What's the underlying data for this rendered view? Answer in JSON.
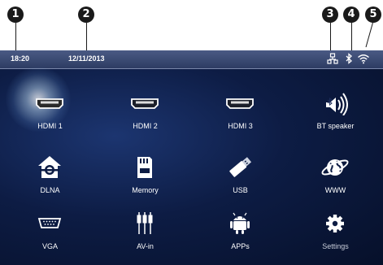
{
  "callouts": [
    "1",
    "2",
    "3",
    "4",
    "5"
  ],
  "status_bar": {
    "time": "18:20",
    "date": "12/11/2013",
    "icons": [
      "network-icon",
      "bluetooth-icon",
      "wifi-icon"
    ]
  },
  "menu": {
    "selected": "HDMI 1",
    "items": [
      {
        "label": "HDMI 1",
        "icon": "hdmi-icon"
      },
      {
        "label": "HDMI 2",
        "icon": "hdmi-icon"
      },
      {
        "label": "HDMI 3",
        "icon": "hdmi-icon"
      },
      {
        "label": "BT speaker",
        "icon": "bt-speaker-icon"
      },
      {
        "label": "DLNA",
        "icon": "dlna-icon"
      },
      {
        "label": "Memory",
        "icon": "memory-card-icon"
      },
      {
        "label": "USB",
        "icon": "usb-icon"
      },
      {
        "label": "WWW",
        "icon": "globe-icon"
      },
      {
        "label": "VGA",
        "icon": "vga-icon"
      },
      {
        "label": "AV-in",
        "icon": "av-in-icon"
      },
      {
        "label": "APPs",
        "icon": "android-icon"
      },
      {
        "label": "Settings",
        "icon": "gear-icon"
      }
    ]
  },
  "colors": {
    "screen_background": "#0d1c44",
    "status_bar": "#3a4a74",
    "marker": "#1a1a1a"
  }
}
